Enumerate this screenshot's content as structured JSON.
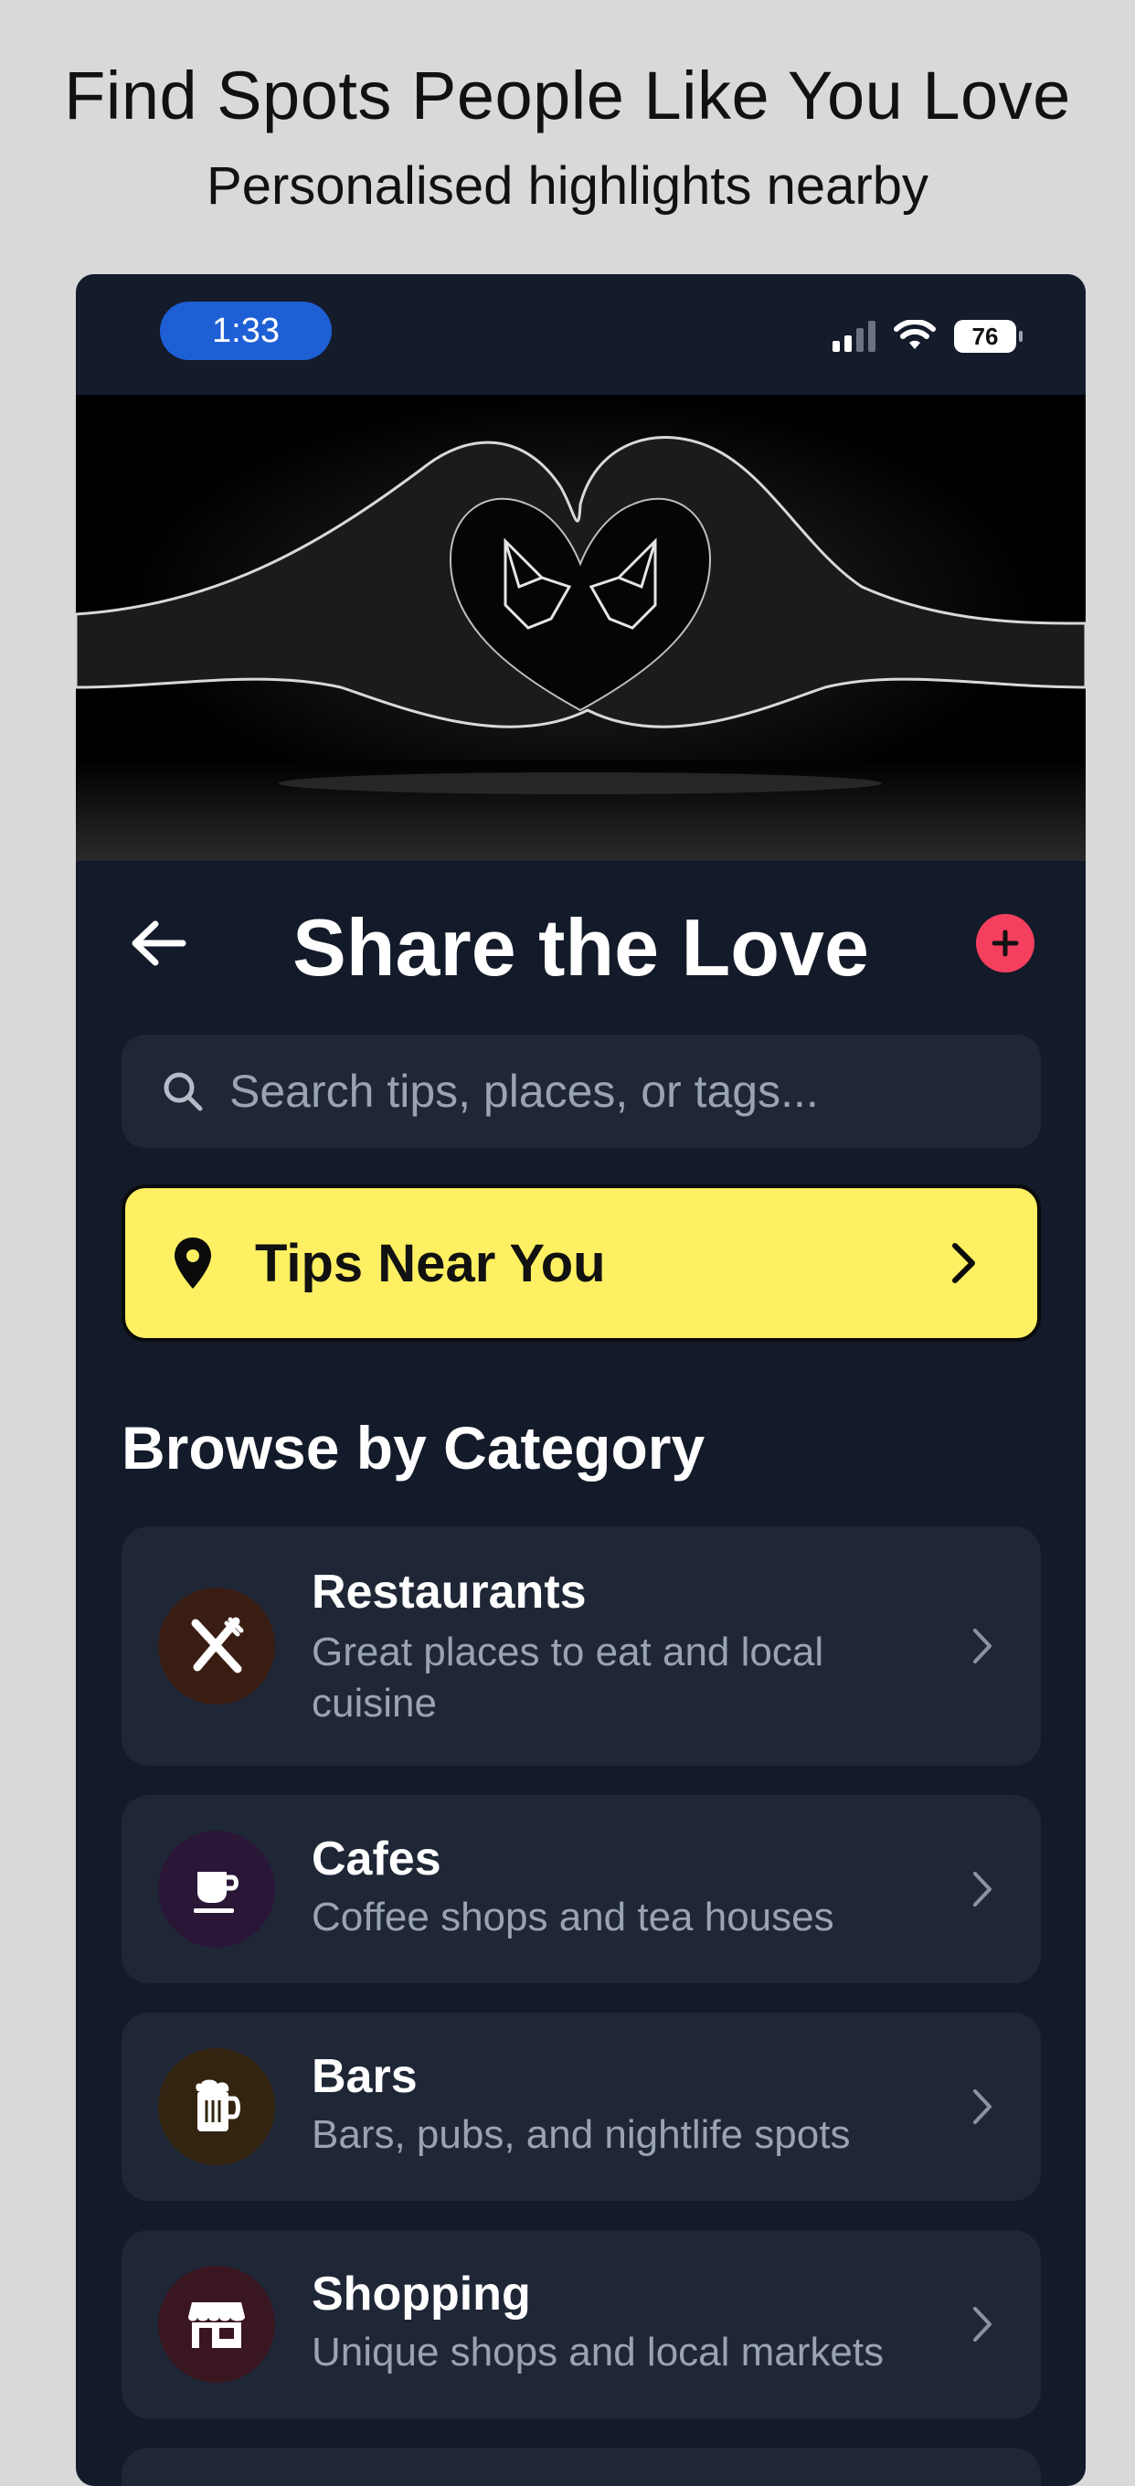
{
  "promo": {
    "title": "Find Spots People Like You Love",
    "subtitle": "Personalised highlights nearby"
  },
  "status_bar": {
    "time": "1:33",
    "battery": "76"
  },
  "hero": {
    "image": "heart-hands-doves"
  },
  "header": {
    "title": "Share the Love",
    "back_icon": "arrow-left-icon",
    "add_icon": "plus-circle-icon"
  },
  "search": {
    "placeholder": "Search tips, places, or tags...",
    "value": ""
  },
  "tips_button": {
    "label": "Tips Near You"
  },
  "categories": {
    "title": "Browse by Category",
    "items": [
      {
        "name": "Restaurants",
        "description": "Great places to eat and local cuisine",
        "icon": "utensils-icon",
        "color": "#3a1d12"
      },
      {
        "name": "Cafes",
        "description": "Coffee shops and tea houses",
        "icon": "coffee-cup-icon",
        "color": "#2a1738"
      },
      {
        "name": "Bars",
        "description": "Bars, pubs, and nightlife spots",
        "icon": "beer-mug-icon",
        "color": "#33240f"
      },
      {
        "name": "Shopping",
        "description": "Unique shops and local markets",
        "icon": "storefront-icon",
        "color": "#3a1620"
      }
    ]
  },
  "colors": {
    "background": "#131a29",
    "card": "#1f2737",
    "accent_yellow": "#fef062",
    "accent_red": "#f43f5e",
    "time_pill": "#1f5fd6"
  }
}
